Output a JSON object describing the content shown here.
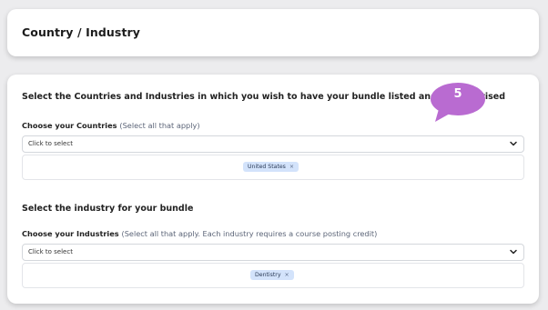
{
  "header": {
    "title": "Country / Industry"
  },
  "intro_heading": "Select the Countries and Industries in which you wish to have your bundle listed and/or advertised",
  "countries": {
    "label": "Choose your Countries",
    "hint": "(Select all that apply)",
    "placeholder": "Click to select",
    "selected": [
      {
        "label": "United States",
        "remove": "×"
      }
    ]
  },
  "industry_heading": "Select the industry for your bundle",
  "industries": {
    "label": "Choose your Industries",
    "hint": "(Select all that apply. Each industry requires a course posting credit)",
    "placeholder": "Click to select",
    "selected": [
      {
        "label": "Dentistry",
        "remove": "×"
      }
    ]
  },
  "step_badge": {
    "number": "5",
    "color": "#b96bd1"
  }
}
